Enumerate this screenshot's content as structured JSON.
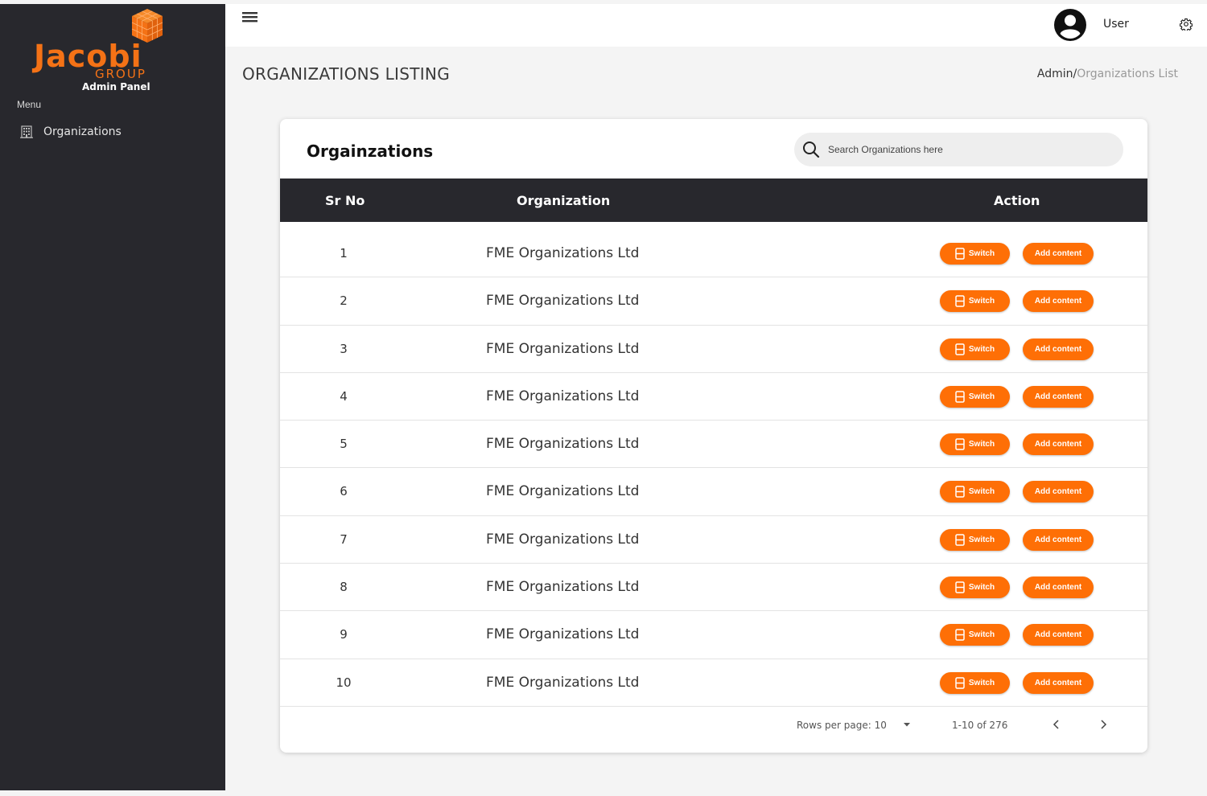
{
  "brand": {
    "word": "Jacobi",
    "group": "GROUP",
    "panel": "Admin Panel",
    "accent_color": "#f47216"
  },
  "sidebar": {
    "menu_label": "Menu",
    "items": [
      {
        "label": "Organizations",
        "icon": "building-icon"
      }
    ]
  },
  "topbar": {
    "user_name": "User",
    "avatar_icon": "user-circle-icon",
    "settings_icon": "gear-icon",
    "menu_icon": "hamburger-icon"
  },
  "page": {
    "title": "ORGANIZATIONS LISTING",
    "breadcrumb": {
      "root": "Admin",
      "separator": "/",
      "current": "Organizations List"
    }
  },
  "card": {
    "title": "Orgainzations",
    "search": {
      "placeholder": "Search Organizations here",
      "value": ""
    }
  },
  "table": {
    "columns": [
      "Sr No",
      "Organization",
      "Action"
    ],
    "switch_label": "Switch",
    "add_label": "Add content",
    "button_color": "#fe6f06",
    "rows": [
      {
        "sr": "1",
        "org": "FME Organizations Ltd"
      },
      {
        "sr": "2",
        "org": "FME Organizations Ltd"
      },
      {
        "sr": "3",
        "org": "FME Organizations Ltd"
      },
      {
        "sr": "4",
        "org": "FME Organizations Ltd"
      },
      {
        "sr": "5",
        "org": "FME Organizations Ltd"
      },
      {
        "sr": "6",
        "org": "FME Organizations Ltd"
      },
      {
        "sr": "7",
        "org": "FME Organizations Ltd"
      },
      {
        "sr": "8",
        "org": "FME Organizations Ltd"
      },
      {
        "sr": "9",
        "org": "FME Organizations Ltd"
      },
      {
        "sr": "10",
        "org": "FME Organizations Ltd"
      }
    ]
  },
  "pagination": {
    "rows_per_page": "Rows per page: 10",
    "range": "1-10 of 276"
  }
}
